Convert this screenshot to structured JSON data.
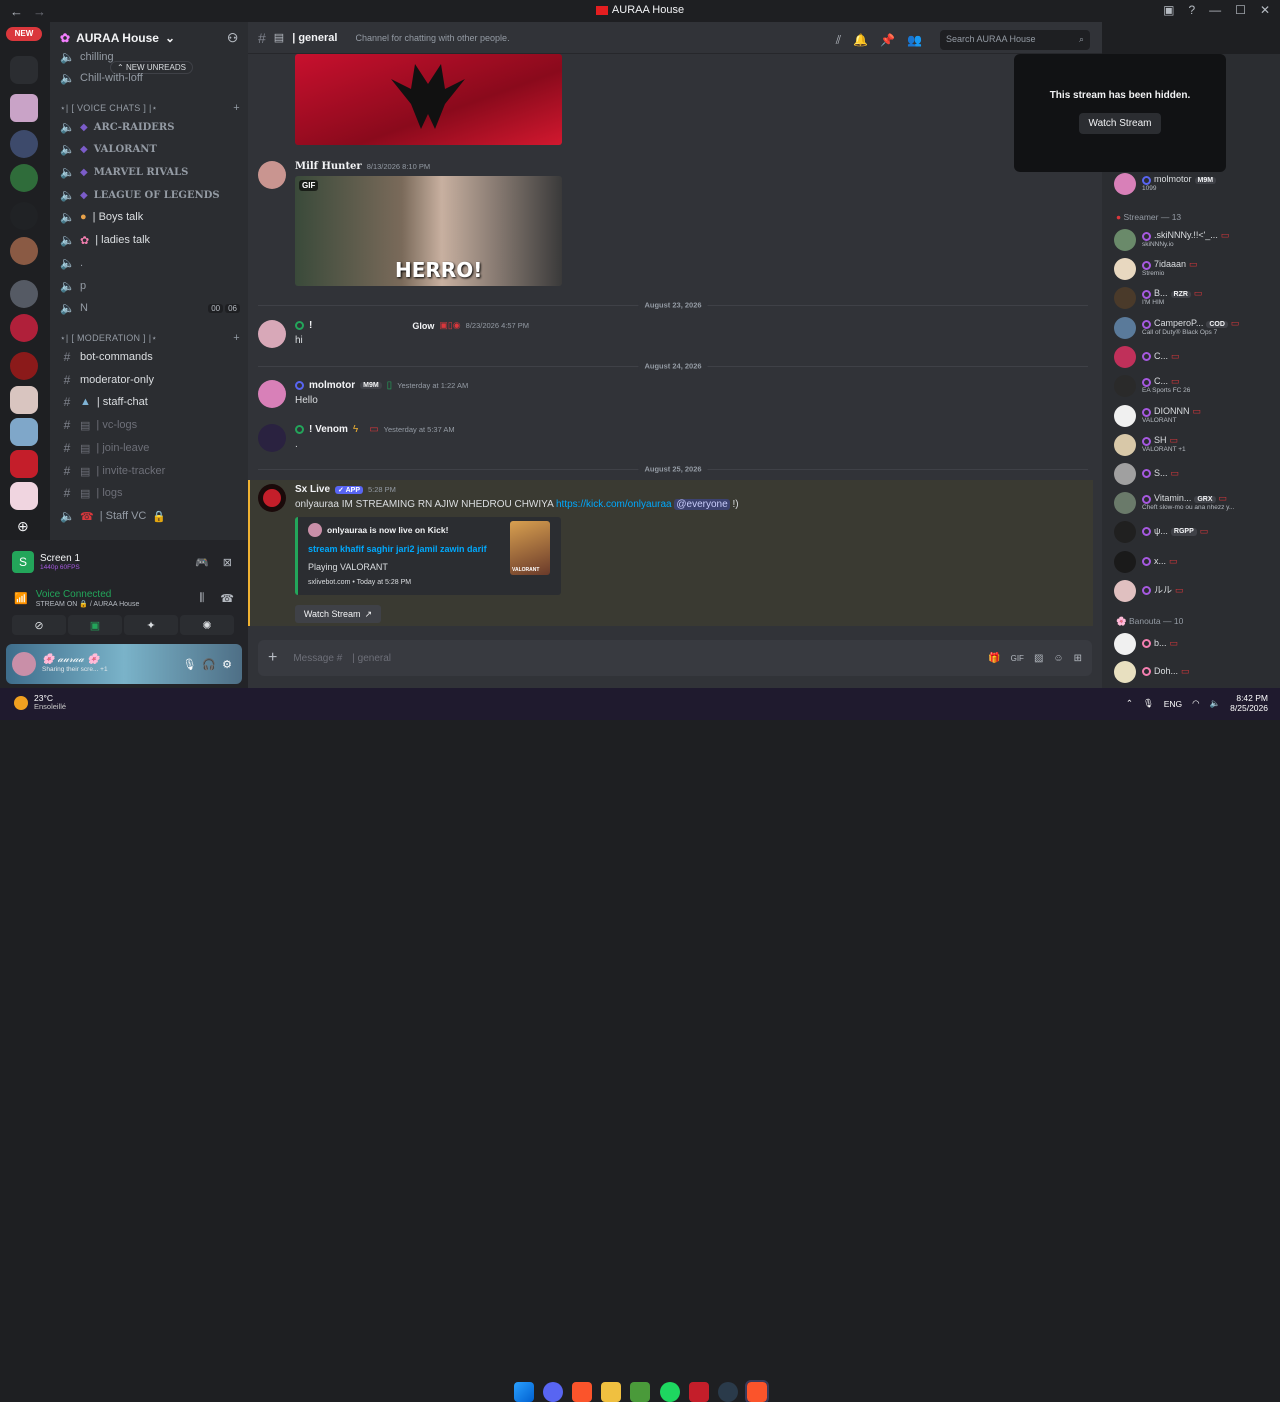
{
  "window": {
    "title": "AURAA House"
  },
  "servers": {
    "new_label": "NEW"
  },
  "server": {
    "name": "AURAA House"
  },
  "channels": {
    "new_unreads": "NEW UNREADS",
    "items": [
      {
        "label": "chilling"
      },
      {
        "label": "Chill-with-loff"
      },
      {
        "label": "⋆| [ VOICE CHATS ] |⋆"
      },
      {
        "label": "ARC-RAIDERS"
      },
      {
        "label": "VALORANT"
      },
      {
        "label": "MARVEL RIVALS"
      },
      {
        "label": "LEAGUE OF LEGENDS"
      },
      {
        "label": "| Boys talk"
      },
      {
        "label": "| ladies talk"
      },
      {
        "label": "."
      },
      {
        "label": "p"
      },
      {
        "label": "N",
        "counts": [
          "00",
          "06"
        ]
      },
      {
        "label": "⋆| [ MODERATION ] |⋆"
      },
      {
        "label": "bot-commands"
      },
      {
        "label": "moderator-only"
      },
      {
        "label": "| staff-chat"
      },
      {
        "label": "| vc-logs"
      },
      {
        "label": "| join-leave"
      },
      {
        "label": "| invite-tracker"
      },
      {
        "label": "| logs"
      },
      {
        "label": "| Staff VC"
      }
    ]
  },
  "stream": {
    "name": "Screen 1",
    "quality": "1440p 60FPS"
  },
  "voice": {
    "status": "Voice Connected",
    "detail": "STREAM ON 🔒 / AURAA House"
  },
  "user": {
    "name": "🌸 𝒶𝓊𝓇𝒶𝒶 🌸",
    "status": "Sharing their scre... +1"
  },
  "chat": {
    "channel_name": "| general",
    "topic": "Channel for chatting with other people.",
    "search_placeholder": "Search AURAA House",
    "dates": [
      "August 23, 2026",
      "August 24, 2026",
      "August 25, 2026"
    ],
    "gif_label": "GIF",
    "gif_caption": "HERRO!",
    "messages": [
      {
        "author": "Milf Hunter",
        "time": "8/13/2026 8:10 PM",
        "text": ""
      },
      {
        "author": "!",
        "tag": "Glow",
        "time": "8/23/2026 4:57 PM",
        "text": "hi"
      },
      {
        "author": "molmotor",
        "tag": "M9M",
        "time": "Yesterday at 1:22 AM",
        "text": "Hello"
      },
      {
        "author": "! Venom",
        "time": "Yesterday at 5:37 AM",
        "text": "."
      },
      {
        "author": "Sx Live",
        "app_label": "APP",
        "time": "5:28 PM",
        "text": "onlyauraa IM STREAMING RN AJIW NHEDROU CHWIYA",
        "link": "https://kick.com/onlyauraa",
        "mention": "@everyone",
        "suffix": "!)"
      }
    ],
    "embed": {
      "author": "onlyauraa is now live on Kick!",
      "title": "stream khafif saghir jari2 jamil zawin darif",
      "playing": "Playing VALORANT",
      "footer": "sxlivebot.com • Today at 5:28 PM",
      "thumb_label": "VALORANT",
      "button": "Watch Stream"
    },
    "input_placeholder": "Message #",
    "input_channel": "| general"
  },
  "hidden_stream": {
    "text": "This stream has been hidden.",
    "button": "Watch Stream"
  },
  "members": {
    "top": {
      "name": "molmotor",
      "tag": "M9M",
      "sub": "1099"
    },
    "streamer_header": "Streamer — 13",
    "streamers": [
      {
        "name": ".skiNNNy.!!<'_...",
        "sub": "skiNNNy.io"
      },
      {
        "name": "7idaaan",
        "sub": "Stremio"
      },
      {
        "name": "B...",
        "tag": "RZR",
        "sub": "I'M HIM"
      },
      {
        "name": "CamperoP...",
        "tag": "COD",
        "sub": "Call of Duty® Black Ops 7"
      },
      {
        "name": "C...",
        "sub": ""
      },
      {
        "name": "C...",
        "sub": "EA Sports FC 26"
      },
      {
        "name": "DIONNN",
        "sub": "VALORANT"
      },
      {
        "name": "SH",
        "sub": "VALORANT +1"
      },
      {
        "name": "S...",
        "sub": ""
      },
      {
        "name": "Vitamin...",
        "tag": "GRX",
        "sub": "Cheft slow-mo ou ana nhezz y..."
      },
      {
        "name": "ψ...",
        "tag": "RGPP",
        "sub": ""
      },
      {
        "name": "x...",
        "sub": ""
      },
      {
        "name": "ルル",
        "sub": ""
      }
    ],
    "banouta_header": "Banouta — 10",
    "banouta": [
      {
        "name": "b...",
        "sub": ""
      },
      {
        "name": "Doh...",
        "sub": ""
      }
    ]
  },
  "taskbar": {
    "temp": "23°C",
    "weather": "Ensoleillé",
    "lang": "ENG",
    "time": "8:42 PM",
    "date": "8/25/2026"
  },
  "colors": {
    "accent": "#5865f2",
    "online": "#23a55a",
    "mention_bg": "#3a3a32",
    "danger": "#da373c"
  }
}
